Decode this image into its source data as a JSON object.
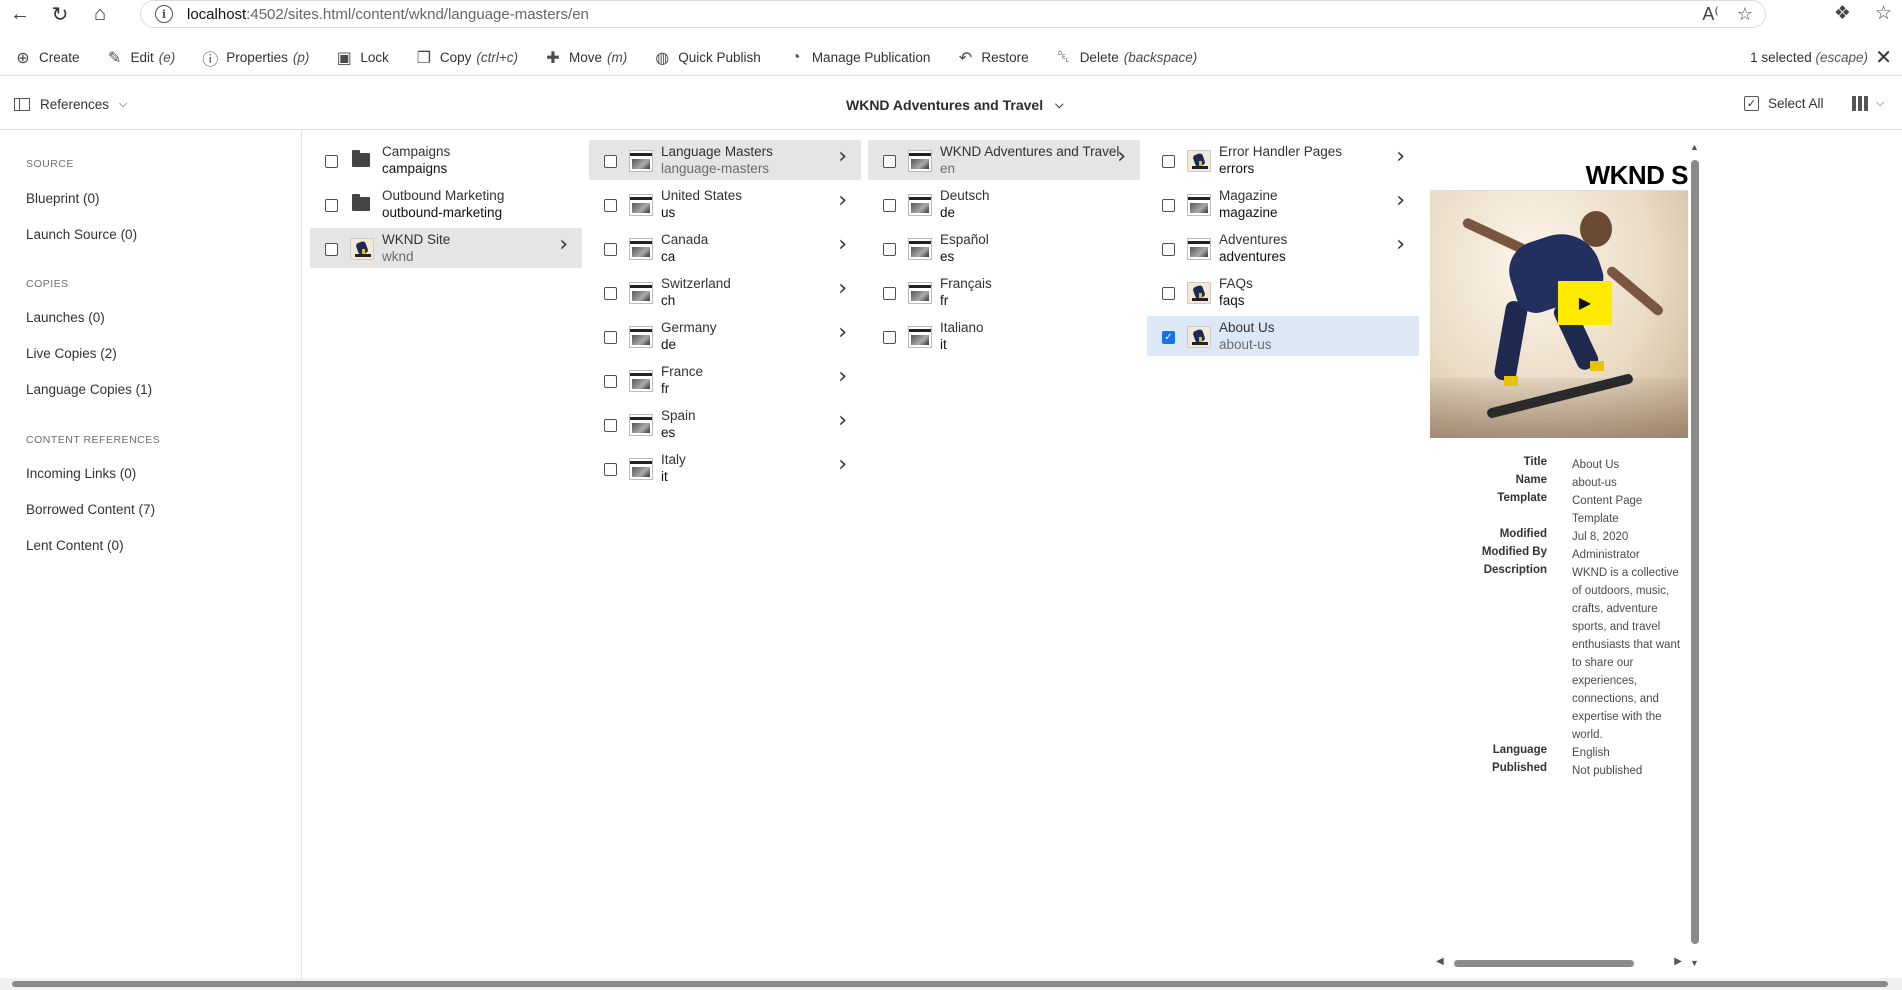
{
  "browser": {
    "url_host": "localhost",
    "url_rest": ":4502/sites.html/content/wknd/language-masters/en"
  },
  "actions": [
    {
      "label": "Create",
      "shortcut": "",
      "icon": "plus-circle-icon"
    },
    {
      "label": "Edit",
      "shortcut": "(e)",
      "icon": "pencil-icon"
    },
    {
      "label": "Properties",
      "shortcut": "(p)",
      "icon": "info-icon"
    },
    {
      "label": "Lock",
      "shortcut": "",
      "icon": "lock-icon"
    },
    {
      "label": "Copy",
      "shortcut": "(ctrl+c)",
      "icon": "copy-icon"
    },
    {
      "label": "Move",
      "shortcut": "(m)",
      "icon": "move-icon"
    },
    {
      "label": "Quick Publish",
      "shortcut": "",
      "icon": "globe-icon"
    },
    {
      "label": "Manage Publication",
      "shortcut": "",
      "icon": "globe-clock-icon"
    },
    {
      "label": "Restore",
      "shortcut": "",
      "icon": "restore-icon"
    },
    {
      "label": "Delete",
      "shortcut": "(backspace)",
      "icon": "trash-icon"
    }
  ],
  "selection": {
    "count_label": "1 selected",
    "escape_hint": "(escape)"
  },
  "toolbar": {
    "references_label": "References",
    "center_title": "WKND Adventures and Travel",
    "select_all_label": "Select All"
  },
  "rail": {
    "source_heading": "SOURCE",
    "blueprint": "Blueprint (0)",
    "launch_source": "Launch Source (0)",
    "copies_heading": "COPIES",
    "launches": "Launches (0)",
    "live_copies": "Live Copies (2)",
    "language_copies": "Language Copies (1)",
    "content_refs_heading": "CONTENT REFERENCES",
    "incoming_links": "Incoming Links (0)",
    "borrowed_content": "Borrowed Content (7)",
    "lent_content": "Lent Content (0)"
  },
  "columns": [
    [
      {
        "title": "Campaigns",
        "name": "campaigns",
        "thumb": "folder",
        "arrow": false,
        "state": ""
      },
      {
        "title": "Outbound Marketing",
        "name": "outbound-marketing",
        "thumb": "folder",
        "arrow": false,
        "state": ""
      },
      {
        "title": "WKND Site",
        "name": "wknd",
        "thumb": "skater",
        "arrow": true,
        "state": "sel"
      }
    ],
    [
      {
        "title": "Language Masters",
        "name": "language-masters",
        "thumb": "page",
        "arrow": true,
        "state": "sel"
      },
      {
        "title": "United States",
        "name": "us",
        "thumb": "page",
        "arrow": true,
        "state": ""
      },
      {
        "title": "Canada",
        "name": "ca",
        "thumb": "page",
        "arrow": true,
        "state": ""
      },
      {
        "title": "Switzerland",
        "name": "ch",
        "thumb": "page",
        "arrow": true,
        "state": ""
      },
      {
        "title": "Germany",
        "name": "de",
        "thumb": "page",
        "arrow": true,
        "state": ""
      },
      {
        "title": "France",
        "name": "fr",
        "thumb": "page",
        "arrow": true,
        "state": ""
      },
      {
        "title": "Spain",
        "name": "es",
        "thumb": "page",
        "arrow": true,
        "state": ""
      },
      {
        "title": "Italy",
        "name": "it",
        "thumb": "page",
        "arrow": true,
        "state": ""
      }
    ],
    [
      {
        "title": "WKND Adventures and Travel",
        "name": "en",
        "thumb": "page",
        "arrow": true,
        "state": "sel"
      },
      {
        "title": "Deutsch",
        "name": "de",
        "thumb": "page",
        "arrow": false,
        "state": ""
      },
      {
        "title": "Español",
        "name": "es",
        "thumb": "page",
        "arrow": false,
        "state": ""
      },
      {
        "title": "Français",
        "name": "fr",
        "thumb": "page",
        "arrow": false,
        "state": ""
      },
      {
        "title": "Italiano",
        "name": "it",
        "thumb": "page",
        "arrow": false,
        "state": ""
      }
    ],
    [
      {
        "title": "Error Handler Pages",
        "name": "errors",
        "thumb": "skater",
        "arrow": true,
        "state": ""
      },
      {
        "title": "Magazine",
        "name": "magazine",
        "thumb": "page",
        "arrow": true,
        "state": ""
      },
      {
        "title": "Adventures",
        "name": "adventures",
        "thumb": "page",
        "arrow": true,
        "state": ""
      },
      {
        "title": "FAQs",
        "name": "faqs",
        "thumb": "skater",
        "arrow": false,
        "state": ""
      },
      {
        "title": "About Us",
        "name": "about-us",
        "thumb": "skater",
        "arrow": false,
        "state": "checked"
      }
    ]
  ],
  "preview": {
    "brand": "WKND S",
    "meta": [
      {
        "k": "Title",
        "v": "About Us"
      },
      {
        "k": "Name",
        "v": "about-us"
      },
      {
        "k": "Template",
        "v": "Content Page Template"
      },
      {
        "k": "Modified",
        "v": "Jul 8, 2020"
      },
      {
        "k": "Modified By",
        "v": "Administrator"
      },
      {
        "k": "Description",
        "v": "WKND is a collective of outdoors, music, crafts, adventure sports, and travel enthusiasts that want to share our experiences, connections, and expertise with the world."
      },
      {
        "k": "Language",
        "v": "English"
      },
      {
        "k": "Published",
        "v": "Not published"
      }
    ]
  }
}
